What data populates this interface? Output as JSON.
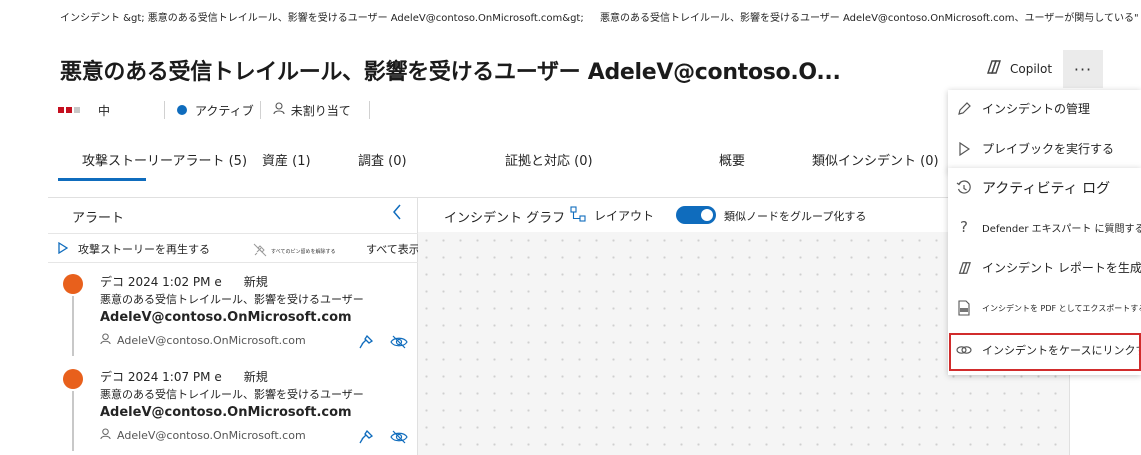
{
  "breadcrumb": {
    "left": "インシデント &gt;  悪意のある受信トレイルール、影響を受けるユーザー  AdeleV@contoso.OnMicrosoft.com&gt;",
    "right": "悪意のある受信トレイルール、影響を受けるユーザー  AdeleV@contoso.OnMicrosoft.com、ユーザーが関与している\""
  },
  "header": {
    "title": "悪意のある受信トレイルール、影響を受けるユーザー AdeleV@contoso.O...",
    "copilot_label": "Copilot",
    "more_label": "···"
  },
  "status": {
    "severity": "中",
    "state": "アクティブ",
    "assignment": "未割り当て"
  },
  "tabs": [
    {
      "label": "攻撃ストーリーアラート (5)"
    },
    {
      "label": "資産 (1)"
    },
    {
      "label": "調査 (0)"
    },
    {
      "label": "証拠と対応 (0)"
    },
    {
      "label": "概要"
    },
    {
      "label": "類似インシデント (0)"
    }
  ],
  "alerts_panel": {
    "title": "アラート",
    "play_label": "攻撃ストーリーを再生する",
    "unpin_label": "すべてのピン留めを解除する",
    "show_all_label": "すべて表示",
    "items": [
      {
        "time": "デコ 2024 1:02 PM e",
        "status": "新規",
        "title": "悪意のある受信トレイルール、影響を受けるユーザー",
        "bold": "AdeleV@contoso.OnMicrosoft.com",
        "user": "AdeleV@contoso.OnMicrosoft.com"
      },
      {
        "time": "デコ 2024 1:07 PM e",
        "status": "新規",
        "title": "悪意のある受信トレイルール、影響を受けるユーザー",
        "bold": "AdeleV@contoso.OnMicrosoft.com",
        "user": "AdeleV@contoso.OnMicrosoft.com"
      }
    ]
  },
  "graph": {
    "title": "インシデント グラフ",
    "layout_label": "レイアウト",
    "group_label": "類似ノードをグループ化する"
  },
  "menu": {
    "manage": "インシデントの管理",
    "playbook": "プレイブックを実行する",
    "activity_log": "アクティビティ ログ",
    "ask_defender": "Defender エキスパート に質問する",
    "report": "インシデント レポートを生成する",
    "export_pdf": "インシデントを PDF としてエクスポートする",
    "link_case": "インシデントをケースにリンクする"
  },
  "colors": {
    "accent": "#0f6cbd",
    "severity": "#c50f1f",
    "alert_dot": "#e8601c",
    "highlight": "#d12c2c"
  }
}
